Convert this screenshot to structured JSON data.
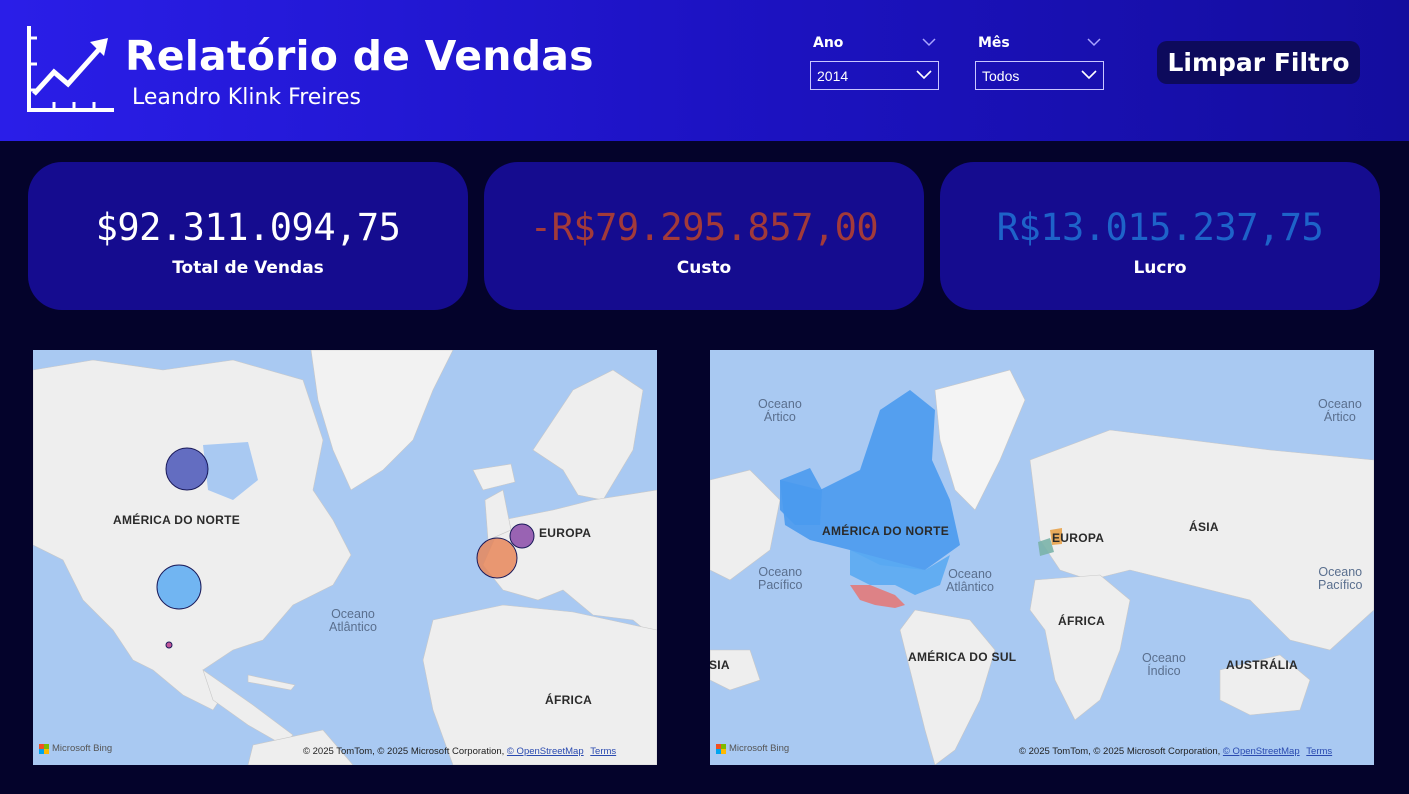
{
  "header": {
    "title": "Relatório de Vendas",
    "subtitle": "Leandro Klink Freires"
  },
  "filters": {
    "year": {
      "label": "Ano",
      "value": "2014"
    },
    "month": {
      "label": "Mês",
      "value": "Todos"
    },
    "clear_label": "Limpar Filtro"
  },
  "kpis": [
    {
      "value": "$92.311.094,75",
      "label": "Total de Vendas",
      "color": "#ffffff"
    },
    {
      "value": "-R$79.295.857,00",
      "label": "Custo",
      "color": "#a23a3a"
    },
    {
      "value": "R$13.015.237,75",
      "label": "Lucro",
      "color": "#1e63c9"
    }
  ],
  "map_left": {
    "labels": {
      "north_america": "AMÉRICA DO NORTE",
      "europe": "EUROPA",
      "ocean_atlantic": "Oceano\nAtlântico",
      "africa": "ÁFRICA"
    },
    "bubbles": [
      {
        "region": "Canada",
        "color": "#4a56b8"
      },
      {
        "region": "United States",
        "color": "#5aaaf2"
      },
      {
        "region": "Mexico",
        "color": "#b83a8a"
      },
      {
        "region": "France",
        "color": "#e8875a"
      },
      {
        "region": "Germany",
        "color": "#8a4aa8"
      }
    ],
    "bing": "Microsoft Bing",
    "attribution": "© 2025 TomTom, © 2025 Microsoft Corporation,",
    "osm": "© OpenStreetMap",
    "terms": "Terms"
  },
  "map_right": {
    "labels": {
      "ocean_arctic_left": "Oceano\nÁrtico",
      "ocean_arctic_right": "Oceano\nÁrtico",
      "north_america": "AMÉRICA DO NORTE",
      "europe": "EUROPA",
      "asia": "ÁSIA",
      "ocean_pacific_left": "Oceano\nPacífico",
      "ocean_atlantic": "Oceano\nAtlântico",
      "ocean_pacific_right": "Oceano\nPacífico",
      "africa": "ÁFRICA",
      "south_america": "AMÉRICA DO SUL",
      "ocean_indian": "Oceano\nÍndico",
      "australia": "AUSTRÁLIA",
      "asia_cut": "ÁSIA"
    },
    "regions": [
      {
        "region": "Canada",
        "color": "#4a9aee"
      },
      {
        "region": "United States",
        "color": "#5aaaf2"
      },
      {
        "region": "Mexico",
        "color": "#e27a7a"
      },
      {
        "region": "France",
        "color": "#7ab3a8"
      },
      {
        "region": "Germany",
        "color": "#e8a24a"
      }
    ],
    "bing": "Microsoft Bing",
    "attribution": "© 2025 TomTom, © 2025 Microsoft Corporation,",
    "osm": "© OpenStreetMap",
    "terms": "Terms"
  }
}
